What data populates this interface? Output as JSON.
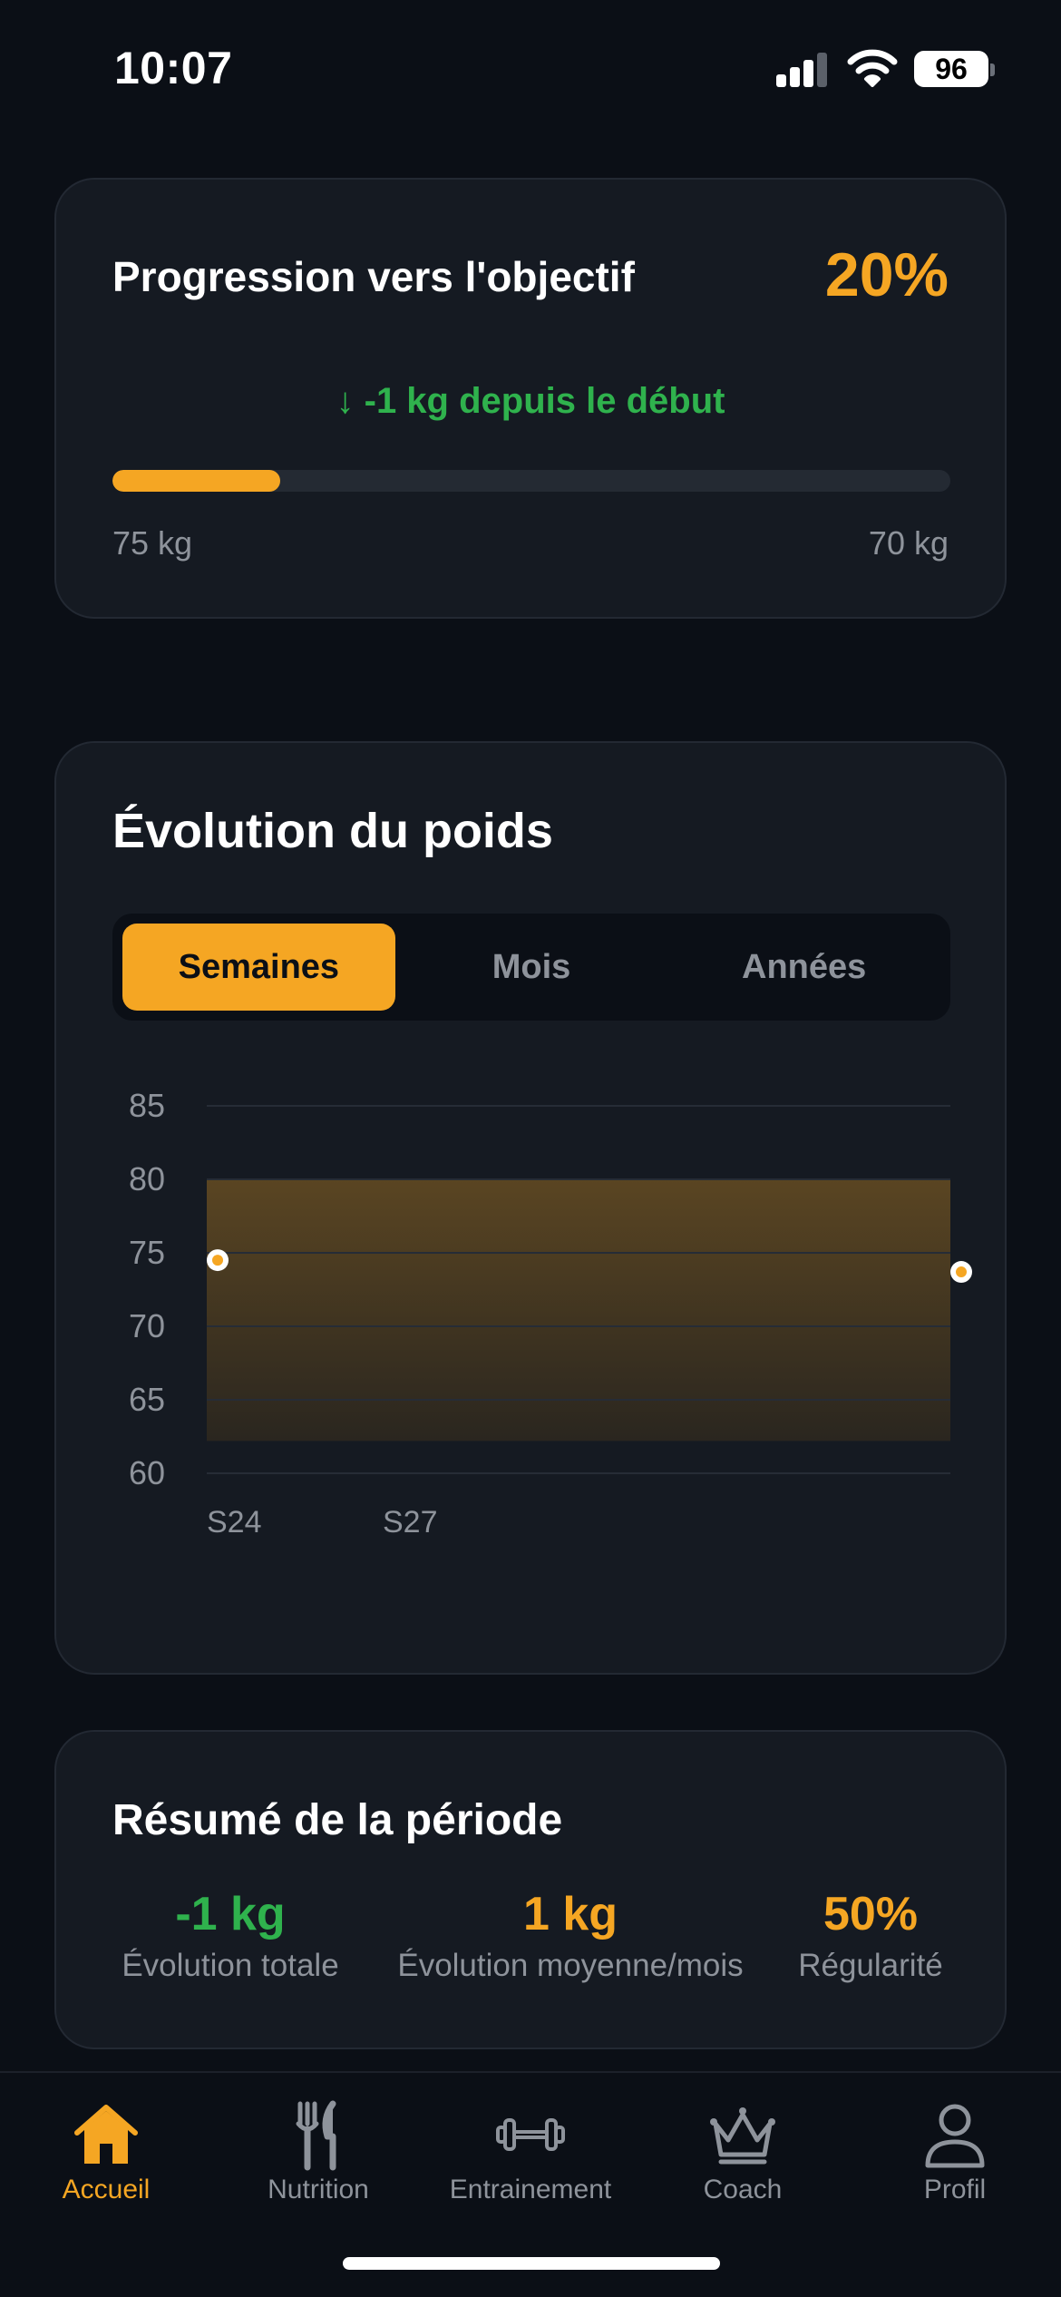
{
  "status_bar": {
    "time": "10:07",
    "battery": "96",
    "icons": [
      "signal-icon",
      "wifi-icon",
      "battery-icon"
    ]
  },
  "goal": {
    "title": "Progression vers l'objectif",
    "percent_label": "20%",
    "progress_fraction": 0.2,
    "change": "↓ -1 kg depuis le début",
    "start": "75 kg",
    "target": "70 kg"
  },
  "weight": {
    "title": "Évolution du poids",
    "segments": [
      "Semaines",
      "Mois",
      "Années"
    ],
    "selected_segment": "Semaines"
  },
  "chart_data": {
    "type": "line",
    "title": "",
    "xlabel": "",
    "ylabel": "",
    "ylim": [
      60,
      85
    ],
    "yticks": [
      "85",
      "80",
      "75",
      "70",
      "65",
      "60"
    ],
    "xticks": [
      "S24",
      "S27"
    ],
    "points": [
      {
        "x": "S24",
        "y": 74.5
      },
      {
        "x": "S27",
        "y": 73.7
      }
    ],
    "band": {
      "from": 62.2,
      "to": 80
    },
    "grid": true,
    "colors": {
      "line": "#f5a623",
      "band": "#5a4522"
    }
  },
  "summary": {
    "title": "Résumé de la période",
    "stats": [
      {
        "value": "-1 kg",
        "label": "Évolution totale",
        "color": "#2fb24d"
      },
      {
        "value": "1 kg",
        "label": "Évolution moyenne/mois",
        "color": "#f5a623"
      },
      {
        "value": "50%",
        "label": "Régularité",
        "color": "#f5a623"
      }
    ]
  },
  "tabs": [
    {
      "label": "Accueil",
      "icon": "home-icon",
      "active": true
    },
    {
      "label": "Nutrition",
      "icon": "fork-knife-icon",
      "active": false
    },
    {
      "label": "Entrainement",
      "icon": "dumbbell-icon",
      "active": false
    },
    {
      "label": "Coach",
      "icon": "crown-icon",
      "active": false
    },
    {
      "label": "Profil",
      "icon": "person-icon",
      "active": false
    }
  ],
  "colors": {
    "accent": "#f5a623",
    "positive": "#2fb24d",
    "background": "#0b0f16",
    "card": "#151a22",
    "muted": "#8e939b"
  }
}
